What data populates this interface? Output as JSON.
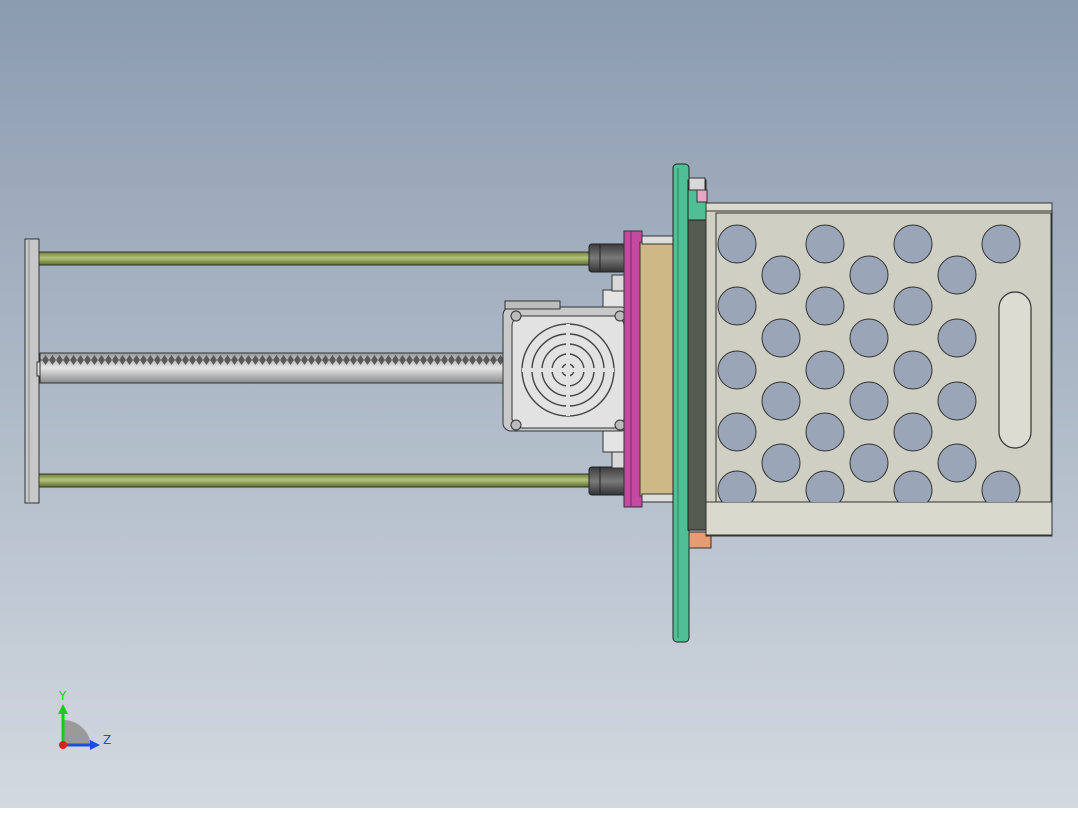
{
  "viewport": {
    "background_top": "#8b9bb0",
    "background_bottom": "#d3d9e0"
  },
  "colors": {
    "rod": "#8fa055",
    "carriage_plate": "#4fbf94",
    "magenta_plate": "#c34a9f",
    "tan_block": "#cdb886",
    "housing": "#cfcfc3",
    "motor": "#d6d6d6",
    "end_plate": "#c8c8c8"
  },
  "triad": {
    "y_label": "Y",
    "z_label": "Z",
    "y_color": "#1ec81e",
    "z_color": "#1a4fe0",
    "x_color": "#e02020"
  }
}
